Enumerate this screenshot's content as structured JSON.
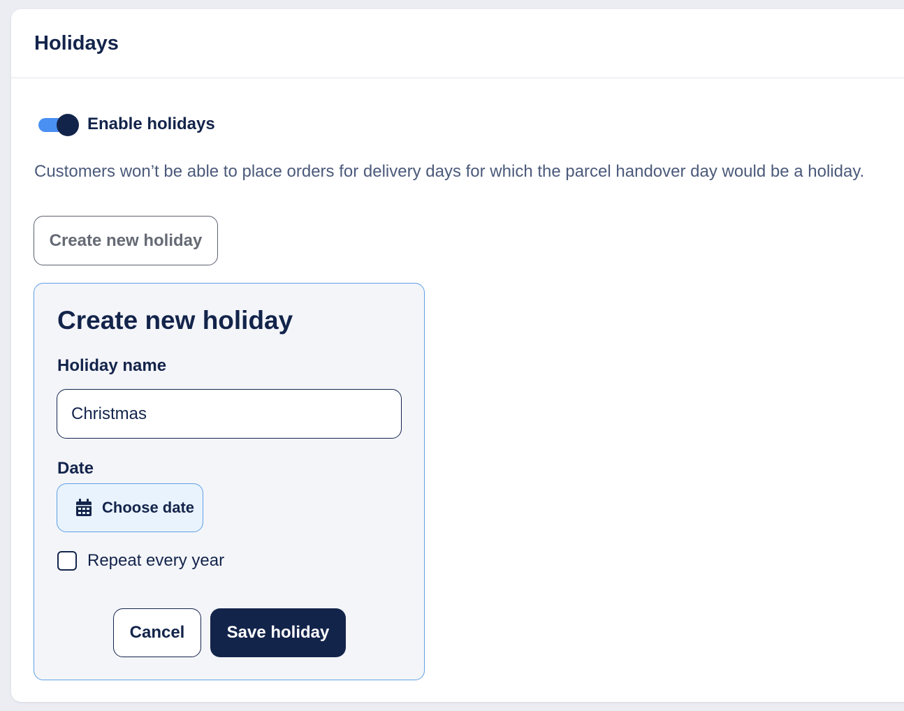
{
  "header": {
    "title": "Holidays"
  },
  "settings": {
    "enable_label": "Enable holidays",
    "enabled": true,
    "description": "Customers won’t be able to place orders for delivery days for which the parcel handover day would be a holiday.",
    "create_button_label": "Create new holiday"
  },
  "form": {
    "title": "Create new holiday",
    "name_label": "Holiday name",
    "name_value": "Christmas",
    "date_label": "Date",
    "date_button_label": "Choose date",
    "repeat_label": "Repeat every year",
    "repeat_checked": false,
    "cancel_label": "Cancel",
    "save_label": "Save holiday"
  },
  "colors": {
    "primary": "#13244b",
    "toggle_track": "#4a8ff2",
    "panel_border": "#5fa0e6",
    "panel_bg": "#f4f5f9",
    "date_button_bg": "#e9f3fd"
  },
  "icons": {
    "date_button": "calendar-icon"
  }
}
